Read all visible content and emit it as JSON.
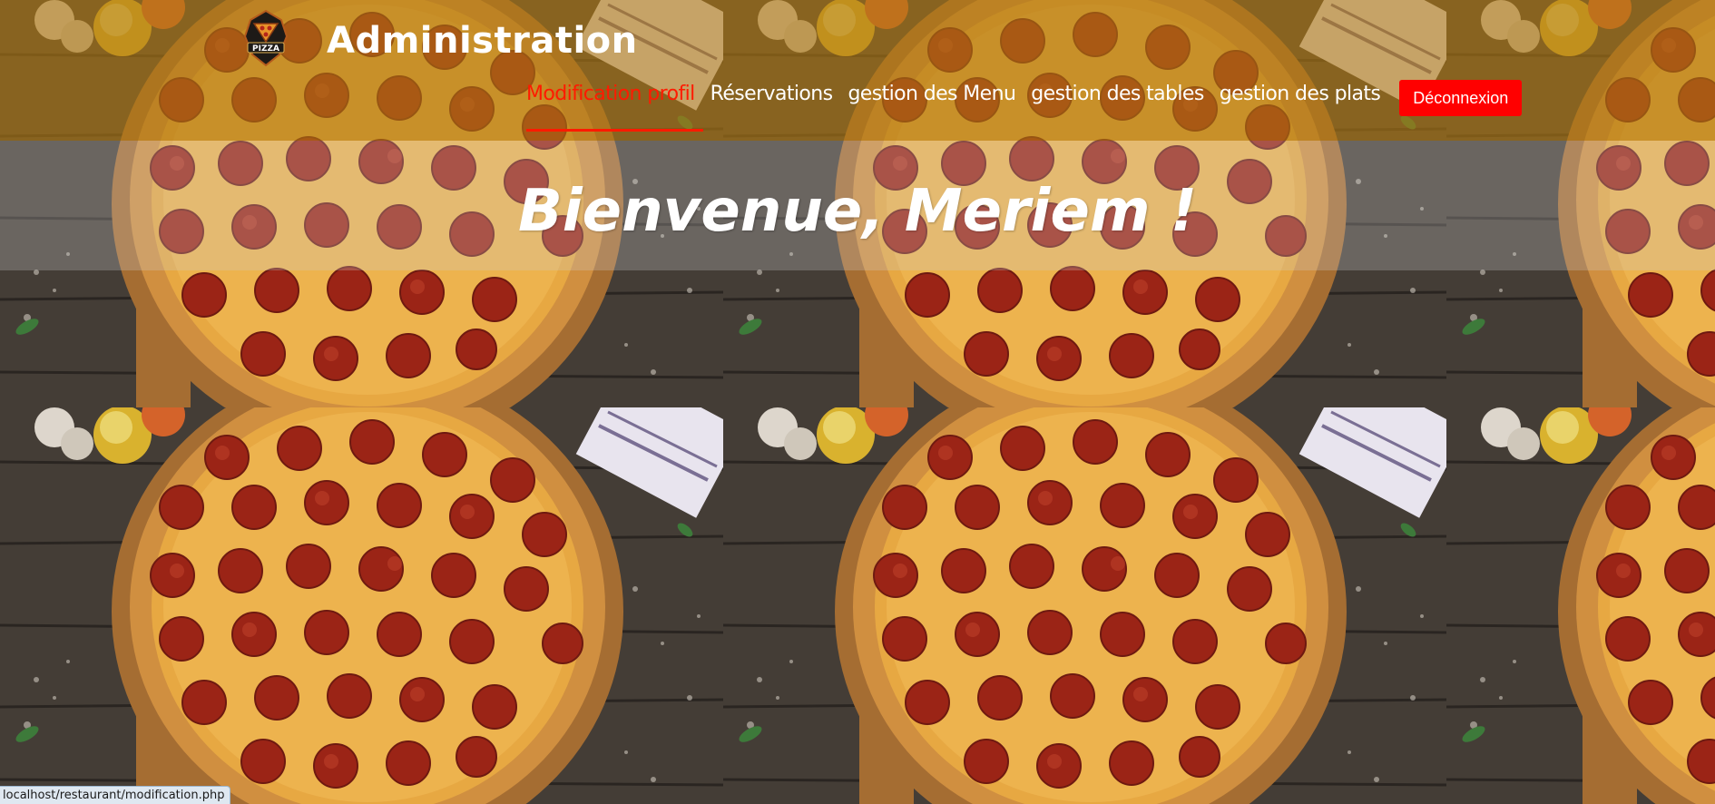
{
  "header": {
    "logo_text": "PIZZA",
    "title": "Administration"
  },
  "nav": {
    "items": [
      {
        "label": "Modification profil",
        "active": true
      },
      {
        "label": "Réservations",
        "active": false
      },
      {
        "label": "gestion des Menu",
        "active": false
      },
      {
        "label": "gestion des tables",
        "active": false
      },
      {
        "label": "gestion des plats",
        "active": false
      }
    ],
    "logout_label": "Déconnexion"
  },
  "welcome": {
    "text": "Bienvenue, Meriem !"
  },
  "status_bar": {
    "url": "localhost/restaurant/modification.php"
  },
  "colors": {
    "header_overlay": "#b27a14",
    "active_nav": "#ff1a00",
    "logout_button": "#ff0000",
    "welcome_text": "#ffffff"
  },
  "icons": {
    "logo": "pizza-logo-icon"
  }
}
